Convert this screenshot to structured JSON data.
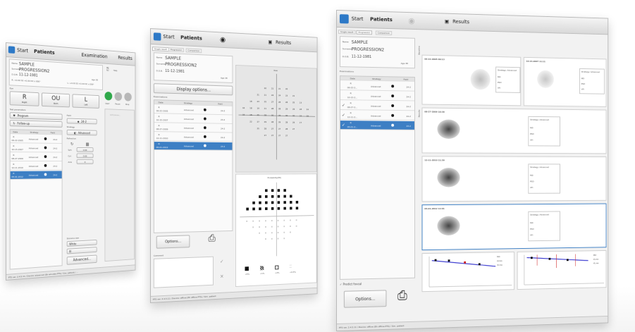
{
  "colors": {
    "accent": "#3d7fc4",
    "progress_line": "#3a3ad0",
    "marker_red": "#d02020"
  },
  "windows": {
    "examination": {
      "title_start": "Start",
      "title_app": "Patients",
      "title_section": "Examination",
      "title_results": "Results",
      "patient": {
        "name_label": "Name",
        "name": "SAMPLE",
        "surname_label": "Surname",
        "surname": "PROGRESSION2",
        "dob_label": "D.O.B.",
        "dob": "11-12-1981",
        "rx": "R: +0.00 SS +0.00 DC x 000°",
        "rx_l": "L: +0.00 SS +0.00 DC x 000°",
        "age": "Age 38"
      },
      "eye_label": "Eye",
      "eyes": [
        {
          "label": "R",
          "sub": "Right"
        },
        {
          "label": "OU",
          "sub": "Both"
        },
        {
          "label": "L",
          "sub": "Left"
        }
      ],
      "test_params_label": "Test parameters",
      "program_label": "Program",
      "followup_label": "Follow-up",
      "field_label": "Field",
      "field_value": "24-2",
      "strategy_label": "Strategy",
      "strategy_value": "Advanced",
      "refraction_label": "Refraction",
      "sph_label": "Sph.",
      "sph_value": "0.00",
      "cyl_label": "Cyl.",
      "cyl_value": "0.00",
      "axis_label": "Axis",
      "axis_value": "0",
      "stim_label": "Stimulus size",
      "stim_color": "White",
      "stim_size": "III",
      "advanced_button": "Advanced...",
      "help_label": "Help",
      "play_labels": [
        "Start",
        "Pause",
        "Stop"
      ],
      "add_pause": "Add pause...",
      "table_headers": [
        "Date",
        "Strategy",
        "Field"
      ],
      "rows": [
        {
          "eye": "R",
          "date": "06-22-2005",
          "strategy": "Advanced",
          "field": "24-2"
        },
        {
          "eye": "R",
          "date": "10-15-2007",
          "strategy": "Advanced",
          "field": "24-2"
        },
        {
          "eye": "R",
          "date": "08-27-2009",
          "strategy": "Advanced",
          "field": "24-2"
        },
        {
          "eye": "R",
          "date": "12-11-2010",
          "strategy": "Advanced",
          "field": "24-2"
        },
        {
          "eye": "R",
          "date": "05-01-2012",
          "strategy": "Advanced",
          "field": "24-2"
        }
      ],
      "status": "PTS ver. 2.4.5.11 / Device: advanced (Eh emulate PTS) / Sim. patient / ..."
    },
    "results": {
      "title_start": "Start",
      "title_app": "Patients",
      "title_results": "Results",
      "tabs": [
        "Single result",
        "Progression",
        "Comparison"
      ],
      "patient": {
        "name_label": "Name",
        "name": "SAMPLE",
        "surname_label": "Surname",
        "surname": "PROGRESSION2",
        "dob_label": "D.O.B.",
        "dob": "11-12-1981",
        "age": "Age 38"
      },
      "display_options": "Display options...",
      "examinations_label": "Examinations",
      "table_headers": [
        "Date",
        "Strategy",
        "Field"
      ],
      "rows": [
        {
          "eye": "R",
          "date": "06-22-2005",
          "strategy": "Advanced",
          "field": "24-2"
        },
        {
          "eye": "R",
          "date": "10-15-2007",
          "strategy": "Advanced",
          "field": "24-2"
        },
        {
          "eye": "R",
          "date": "08-27-2009",
          "strategy": "Advanced",
          "field": "24-2"
        },
        {
          "eye": "R",
          "date": "12-11-2010",
          "strategy": "Advanced",
          "field": "24-2"
        },
        {
          "eye": "R",
          "date": "05-01-2012",
          "strategy": "Advanced",
          "field": "24-2"
        }
      ],
      "options_button": "Options...",
      "comment_label": "Comment",
      "raw_title": "Raw",
      "raw_values": [
        [
          "",
          "",
          "",
          "20",
          "21",
          "21",
          "20",
          "",
          "",
          ""
        ],
        [
          "",
          "",
          "21",
          "21",
          "24",
          "24",
          "23",
          "21",
          "",
          ""
        ],
        [
          "",
          "18",
          "23",
          "25",
          "27",
          "28",
          "28",
          "25",
          "23",
          ""
        ],
        [
          "16",
          "18",
          "19",
          "21",
          "28",
          "28",
          "29",
          "29",
          "28",
          "24"
        ],
        [
          "16",
          "18",
          "25",
          "28",
          "30",
          "29",
          "30",
          "30",
          "29",
          "28"
        ],
        [
          "",
          "22",
          "27",
          "29",
          "28",
          "29",
          "28",
          "29",
          "27",
          ""
        ],
        [
          "",
          "",
          "25",
          "28",
          "27",
          "27",
          "28",
          "27",
          "",
          ""
        ],
        [
          "",
          "",
          "",
          "27",
          "27",
          "27",
          "27",
          "",
          "",
          ""
        ]
      ],
      "prob_title": "Probability(PD)",
      "legend": [
        "<5%",
        "<1%",
        "<2%",
        "<0.5%"
      ],
      "status": "PTS ver. 2.4.5.11 / Device: offline (Eh offline PTS) / Sim. patient"
    },
    "progression": {
      "title_start": "Start",
      "title_app": "Patients",
      "title_results": "Results",
      "tabs": [
        "Single result",
        "Progression",
        "Comparison"
      ],
      "patient": {
        "name_label": "Name",
        "name": "SAMPLE",
        "surname_label": "Surname",
        "surname": "PROGRESSION2",
        "dob_label": "D.O.B.",
        "dob": "11-12-1981",
        "age": "Age 38"
      },
      "examinations_label": "Examinations",
      "table_headers": [
        "Date",
        "Strategy",
        "Field"
      ],
      "rows": [
        {
          "eye": "R",
          "date": "06-22-2...",
          "strategy": "Advanced",
          "field": "24-2",
          "checked": false
        },
        {
          "eye": "R",
          "date": "10-15-2...",
          "strategy": "Advanced",
          "field": "24-2",
          "checked": false
        },
        {
          "eye": "R",
          "date": "08-27-2...",
          "strategy": "Advanced",
          "field": "24-2",
          "checked": true
        },
        {
          "eye": "R",
          "date": "12-11-2...",
          "strategy": "Advanced",
          "field": "24-2",
          "checked": true
        },
        {
          "eye": "R",
          "date": "05-01-2...",
          "strategy": "Advanced",
          "field": "24-2",
          "checked": true
        }
      ],
      "predict_foveal": "Predict foveal",
      "options_button": "Options...",
      "baseline_label": "Baseline",
      "results_label": "Results",
      "panels": [
        {
          "date": "06-22-2005 09:13",
          "strategy": "Strategy: Advanced"
        },
        {
          "date": "10-15-2007 11:11",
          "strategy": "Strategy: Advanced"
        },
        {
          "date": "08-27-2009 10:38",
          "strategy": "Strategy: Advanced"
        },
        {
          "date": "12-11-2010 11:30",
          "strategy": "Strategy: Advanced"
        },
        {
          "date": "05-01-2012 11:01",
          "strategy": "Strategy: Advanced"
        }
      ],
      "indices": [
        "MD",
        "PSD",
        "VFI"
      ],
      "graph_legend": [
        "MD",
        "sLoss",
        "dLoss"
      ],
      "status": "PTS ver. 2.4.5.11 / Device: offline (Eh offline PTS) / Sim. patient"
    }
  }
}
